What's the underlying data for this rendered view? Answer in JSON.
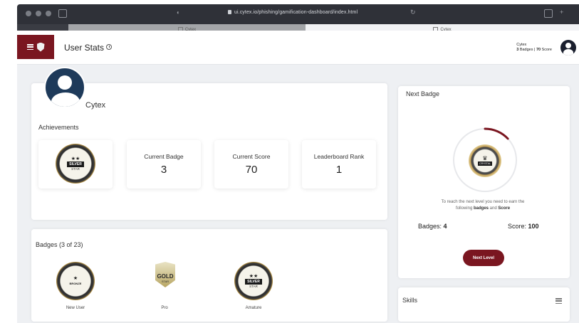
{
  "browser": {
    "url": "ui.cytex.io/phishing/gamification-dashboard/index.html",
    "tabs": [
      {
        "label": "Cytex"
      },
      {
        "label": "Cytex"
      }
    ]
  },
  "header": {
    "title": "User Stats",
    "user_name": "Cytex",
    "user_badges": "3",
    "user_badges_label": "Badges",
    "user_score": "70",
    "user_score_label": "Score"
  },
  "profile": {
    "name": "Cytex",
    "achievements_title": "Achievements",
    "current_badge": {
      "stars": "★★",
      "name": "SILVER",
      "sub": "STAR"
    },
    "stats": [
      {
        "label": "Current Badge",
        "value": "3"
      },
      {
        "label": "Current Score",
        "value": "70"
      },
      {
        "label": "Leaderboard Rank",
        "value": "1"
      }
    ]
  },
  "badges": {
    "title": "Badges (3 of 23)",
    "items": [
      {
        "caption": "New User",
        "icon": "bronze-star-badge-icon",
        "stars": "★",
        "name": "BRONZE",
        "sub": "STAR"
      },
      {
        "caption": "Pro",
        "icon": "gold-star-badge-icon",
        "name": "GOLD",
        "sub": "STAR"
      },
      {
        "caption": "Amature",
        "icon": "silver-star-badge-icon",
        "stars": "★★",
        "name": "SILVER",
        "sub": "STAR"
      }
    ]
  },
  "next_badge": {
    "title": "Next Badge",
    "badge_name": "CRYSTAL",
    "badge_sub": "STAR",
    "progress": 0.13,
    "message_line1": "To reach the next level you need to earn the",
    "message_pre": "following",
    "message_badges": "badges",
    "message_and": "and",
    "message_score": "Score",
    "badges_label": "Badges:",
    "badges_required": "4",
    "score_label": "Score:",
    "score_required": "100",
    "button_label": "Next Level"
  },
  "skills": {
    "title": "Skills"
  },
  "colors": {
    "brand": "#7a1620",
    "avatar": "#1e3a5a"
  }
}
